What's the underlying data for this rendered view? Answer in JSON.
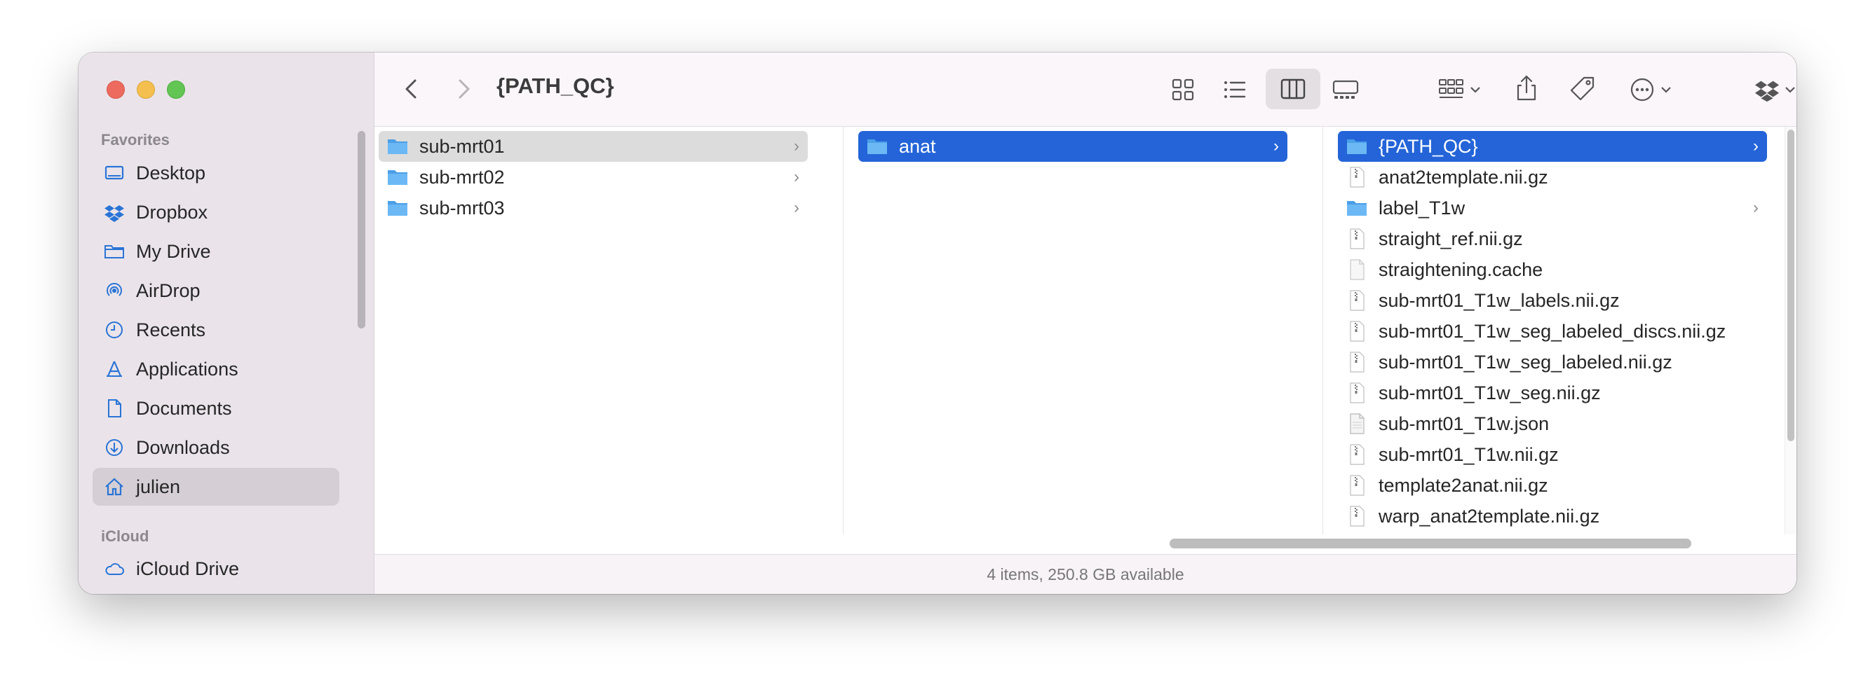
{
  "window": {
    "title": "{PATH_QC}",
    "status": "4 items, 250.8 GB available"
  },
  "sidebar": {
    "sections": [
      {
        "label": "Favorites"
      },
      {
        "label": "iCloud"
      }
    ],
    "favorites": [
      {
        "label": "Desktop",
        "icon": "desktop-icon"
      },
      {
        "label": "Dropbox",
        "icon": "dropbox-icon"
      },
      {
        "label": "My Drive",
        "icon": "folder-icon"
      },
      {
        "label": "AirDrop",
        "icon": "airdrop-icon"
      },
      {
        "label": "Recents",
        "icon": "clock-icon"
      },
      {
        "label": "Applications",
        "icon": "applications-icon"
      },
      {
        "label": "Documents",
        "icon": "document-icon"
      },
      {
        "label": "Downloads",
        "icon": "download-icon"
      },
      {
        "label": "julien",
        "icon": "home-icon",
        "active": true
      }
    ],
    "icloud": [
      {
        "label": "iCloud Drive",
        "icon": "cloud-icon"
      }
    ]
  },
  "columns": [
    {
      "items": [
        {
          "name": "sub-mrt01",
          "type": "folder",
          "selected": "gray"
        },
        {
          "name": "sub-mrt02",
          "type": "folder"
        },
        {
          "name": "sub-mrt03",
          "type": "folder"
        }
      ]
    },
    {
      "items": [
        {
          "name": "anat",
          "type": "folder",
          "selected": "blue"
        }
      ]
    },
    {
      "items": [
        {
          "name": "{PATH_QC}",
          "type": "folder",
          "selected": "blue"
        },
        {
          "name": "anat2template.nii.gz",
          "type": "archive"
        },
        {
          "name": "label_T1w",
          "type": "folder"
        },
        {
          "name": "straight_ref.nii.gz",
          "type": "archive"
        },
        {
          "name": "straightening.cache",
          "type": "file"
        },
        {
          "name": "sub-mrt01_T1w_labels.nii.gz",
          "type": "archive"
        },
        {
          "name": "sub-mrt01_T1w_seg_labeled_discs.nii.gz",
          "type": "archive"
        },
        {
          "name": "sub-mrt01_T1w_seg_labeled.nii.gz",
          "type": "archive"
        },
        {
          "name": "sub-mrt01_T1w_seg.nii.gz",
          "type": "archive"
        },
        {
          "name": "sub-mrt01_T1w.json",
          "type": "json"
        },
        {
          "name": "sub-mrt01_T1w.nii.gz",
          "type": "archive"
        },
        {
          "name": "template2anat.nii.gz",
          "type": "archive"
        },
        {
          "name": "warp_anat2template.nii.gz",
          "type": "archive"
        }
      ]
    }
  ],
  "colors": {
    "selection_blue": "#2464d8",
    "folder_blue": "#5aaef0",
    "sidebar_bg": "#eae4ea"
  }
}
